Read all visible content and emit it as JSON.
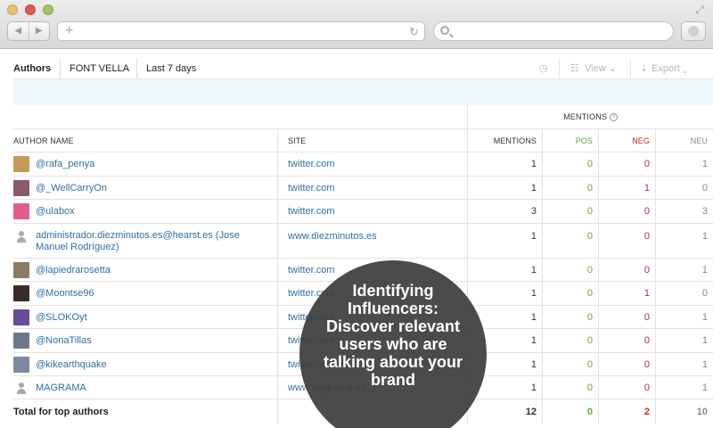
{
  "toolbar": {
    "tabs": [
      "Authors",
      "FONT VELLA",
      "Last 7 days"
    ],
    "view_label": "View",
    "export_label": "Export"
  },
  "table": {
    "group_header": "MENTIONS",
    "columns": {
      "author": "AUTHOR NAME",
      "site": "SITE",
      "mentions": "MENTIONS",
      "pos": "POS",
      "neg": "NEG",
      "neu": "NEU"
    },
    "rows": [
      {
        "author": "@rafa_penya",
        "site": "twitter.com",
        "mentions": "1",
        "pos": "0",
        "neg": "0",
        "neu": "1",
        "avatar": "#c49a5a"
      },
      {
        "author": "@_WellCarryOn",
        "site": "twitter.com",
        "mentions": "1",
        "pos": "0",
        "neg": "1",
        "neu": "0",
        "avatar": "#8a5a6a"
      },
      {
        "author": "@ulabox",
        "site": "twitter.com",
        "mentions": "3",
        "pos": "0",
        "neg": "0",
        "neu": "3",
        "avatar": "#e45c8a"
      },
      {
        "author": "administrador.diezminutos.es@hearst.es (Jose Manuel Rodríguez)",
        "site": "www.diezminutos.es",
        "mentions": "1",
        "pos": "0",
        "neg": "0",
        "neu": "1",
        "avatar": "default"
      },
      {
        "author": "@lapiedrarosetta",
        "site": "twitter.com",
        "mentions": "1",
        "pos": "0",
        "neg": "0",
        "neu": "1",
        "avatar": "#8b7b62"
      },
      {
        "author": "@Moontse96",
        "site": "twitter.com",
        "mentions": "1",
        "pos": "0",
        "neg": "1",
        "neu": "0",
        "avatar": "#3a2a2a"
      },
      {
        "author": "@SLOKOyt",
        "site": "twitter.com",
        "mentions": "1",
        "pos": "0",
        "neg": "0",
        "neu": "1",
        "avatar": "#6a4a9a"
      },
      {
        "author": "@NonaTillas",
        "site": "twitter.com",
        "mentions": "1",
        "pos": "0",
        "neg": "0",
        "neu": "1",
        "avatar": "#6a7a8a"
      },
      {
        "author": "@kikearthquake",
        "site": "twitter.com",
        "mentions": "1",
        "pos": "0",
        "neg": "0",
        "neu": "1",
        "avatar": "#7a8aa0"
      },
      {
        "author": "MAGRAMA",
        "site": "www.magrama.es",
        "mentions": "1",
        "pos": "0",
        "neg": "0",
        "neu": "1",
        "avatar": "default"
      }
    ],
    "total": {
      "label": "Total for top authors",
      "mentions": "12",
      "pos": "0",
      "neg": "2",
      "neu": "10"
    }
  },
  "overlay": {
    "text": "Identifying Influencers: Discover relevant users who are talking about your brand"
  },
  "colors": {
    "link": "#2f6fa5",
    "positive": "#6fa534",
    "negative": "#c0282a",
    "neutral": "#888888",
    "banner": "#f0f8fb"
  }
}
